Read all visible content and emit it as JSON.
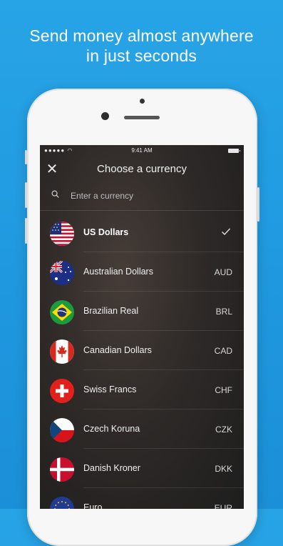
{
  "headline": {
    "line1": "Send money almost anywhere",
    "line2": "in just seconds"
  },
  "status_bar": {
    "signal": "●●●●● ",
    "time": "9:41 AM"
  },
  "screen": {
    "title": "Choose a currency",
    "close_glyph": "✕",
    "search": {
      "placeholder": "Enter a currency",
      "value": ""
    }
  },
  "currencies": [
    {
      "name": "US Dollars",
      "code": "",
      "selected": true,
      "flag": "us-flag"
    },
    {
      "name": "Australian Dollars",
      "code": "AUD",
      "selected": false,
      "flag": "au-flag"
    },
    {
      "name": "Brazilian Real",
      "code": "BRL",
      "selected": false,
      "flag": "br-flag"
    },
    {
      "name": "Canadian Dollars",
      "code": "CAD",
      "selected": false,
      "flag": "ca-flag"
    },
    {
      "name": "Swiss Francs",
      "code": "CHF",
      "selected": false,
      "flag": "ch-flag"
    },
    {
      "name": "Czech Koruna",
      "code": "CZK",
      "selected": false,
      "flag": "cz-flag"
    },
    {
      "name": "Danish Kroner",
      "code": "DKK",
      "selected": false,
      "flag": "dk-flag"
    },
    {
      "name": "Euro",
      "code": "EUR",
      "selected": false,
      "flag": "eu-flag"
    }
  ],
  "colors": {
    "background": "#1f97df",
    "screen": "#2a2624",
    "text": "#ffffff"
  }
}
